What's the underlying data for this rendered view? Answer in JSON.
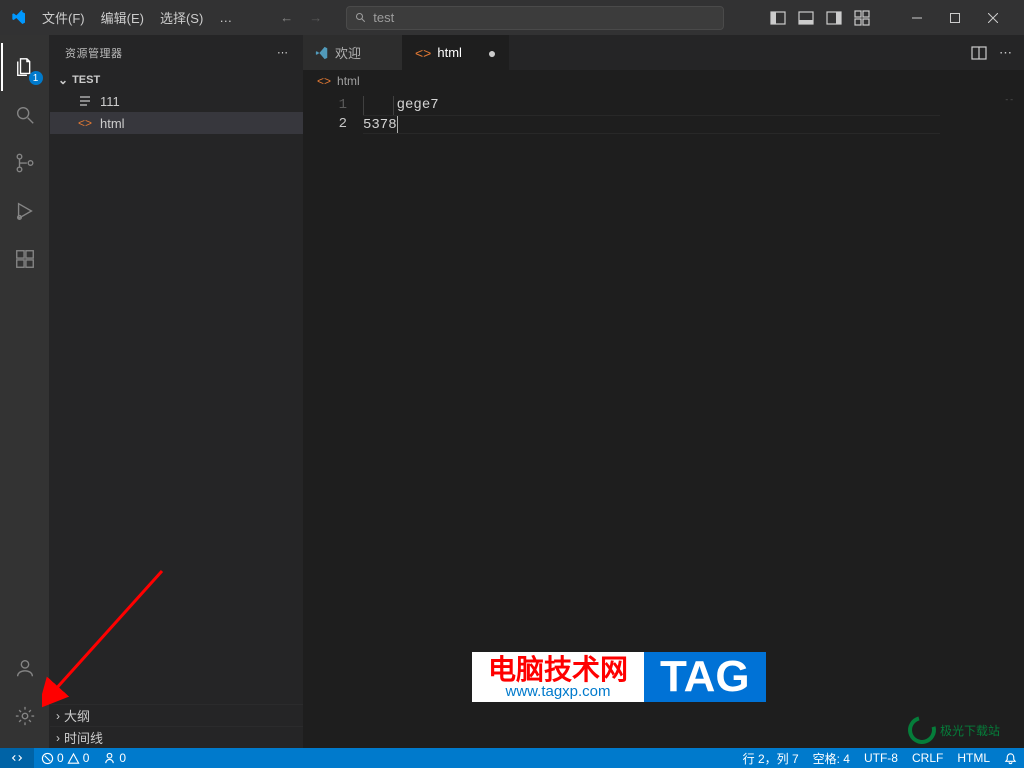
{
  "menubar": {
    "file": "文件(F)",
    "edit": "编辑(E)",
    "select": "选择(S)"
  },
  "search": {
    "text": "test"
  },
  "activitybar": {
    "explorer_badge": "1"
  },
  "sidebar": {
    "title": "资源管理器",
    "folder": "TEST",
    "items": [
      {
        "label": "111",
        "icon": "text-icon"
      },
      {
        "label": "html",
        "icon": "html-icon",
        "selected": true
      }
    ],
    "outline": "大纲",
    "timeline": "时间线"
  },
  "tabs": {
    "welcome": "欢迎",
    "html": "html"
  },
  "breadcrumb": {
    "html": "html"
  },
  "editor": {
    "lines": [
      {
        "n": "1",
        "content": "gege7",
        "pad": "    "
      },
      {
        "n": "2",
        "content": "5378",
        "pad": ""
      }
    ]
  },
  "statusbar": {
    "errors": "0",
    "warnings": "0",
    "ports": "0",
    "line_col": "行 2，列 7",
    "spaces": "空格: 4",
    "encoding": "UTF-8",
    "eol": "CRLF",
    "lang": "HTML"
  },
  "watermark": {
    "label": "电脑技术网",
    "url": "www.tagxp.com",
    "tag": "TAG",
    "jg": "极光下载站"
  }
}
